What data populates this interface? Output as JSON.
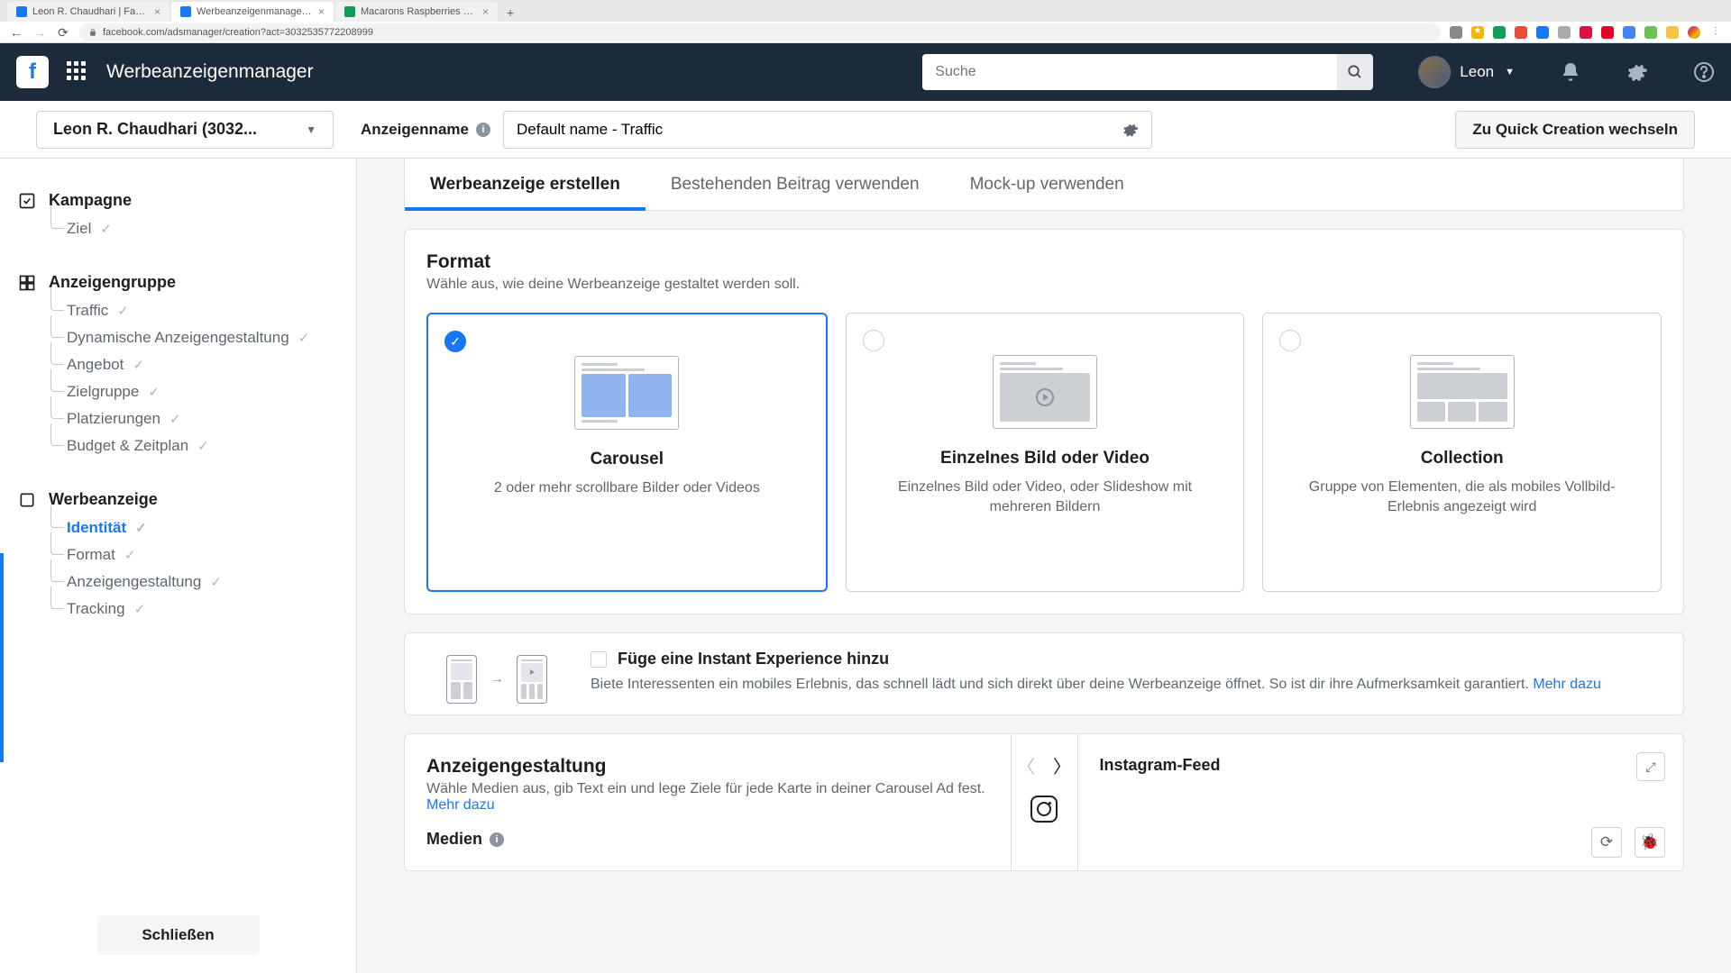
{
  "browser": {
    "tabs": [
      {
        "title": "Leon R. Chaudhari | Facebook",
        "favicon": "#1877f2"
      },
      {
        "title": "Werbeanzeigenmanager - Cre…",
        "favicon": "#1877f2",
        "active": true
      },
      {
        "title": "Macarons Raspberries Pastrie…",
        "favicon": "#0f9d58"
      }
    ],
    "url": "facebook.com/adsmanager/creation?act=3032535772208999"
  },
  "header": {
    "app_title": "Werbeanzeigenmanager",
    "search_placeholder": "Suche",
    "user_name": "Leon"
  },
  "subheader": {
    "account_label": "Leon R. Chaudhari (3032...",
    "ad_name_label": "Anzeigenname",
    "ad_name_value": "Default name - Traffic",
    "quick_btn": "Zu Quick Creation wechseln"
  },
  "sidebar": {
    "sections": [
      {
        "title": "Kampagne",
        "items": [
          {
            "label": "Ziel"
          }
        ]
      },
      {
        "title": "Anzeigengruppe",
        "items": [
          {
            "label": "Traffic"
          },
          {
            "label": "Dynamische Anzeigengestaltung"
          },
          {
            "label": "Angebot"
          },
          {
            "label": "Zielgruppe"
          },
          {
            "label": "Platzierungen"
          },
          {
            "label": "Budget & Zeitplan"
          }
        ]
      },
      {
        "title": "Werbeanzeige",
        "items": [
          {
            "label": "Identität",
            "active": true
          },
          {
            "label": "Format"
          },
          {
            "label": "Anzeigengestaltung"
          },
          {
            "label": "Tracking"
          }
        ]
      }
    ],
    "close": "Schließen"
  },
  "tabs": {
    "items": [
      {
        "label": "Werbeanzeige erstellen",
        "active": true
      },
      {
        "label": "Bestehenden Beitrag verwenden"
      },
      {
        "label": "Mock-up verwenden"
      }
    ]
  },
  "format": {
    "title": "Format",
    "subtitle": "Wähle aus, wie deine Werbeanzeige gestaltet werden soll.",
    "options": [
      {
        "title": "Carousel",
        "desc": "2 oder mehr scrollbare Bilder oder Videos",
        "selected": true
      },
      {
        "title": "Einzelnes Bild oder Video",
        "desc": "Einzelnes Bild oder Video, oder Slideshow mit mehreren Bildern"
      },
      {
        "title": "Collection",
        "desc": "Gruppe von Elementen, die als mobiles Vollbild-Erlebnis angezeigt wird"
      }
    ]
  },
  "instant": {
    "title": "Füge eine Instant Experience hinzu",
    "desc": "Biete Interessenten ein mobiles Erlebnis, das schnell lädt und sich direkt über deine Werbeanzeige öffnet. So ist dir ihre Aufmerksamkeit garantiert. ",
    "link": "Mehr dazu"
  },
  "design": {
    "title": "Anzeigengestaltung",
    "desc": "Wähle Medien aus, gib Text ein und lege Ziele für jede Karte in deiner Carousel Ad fest. ",
    "link": "Mehr dazu",
    "media_label": "Medien",
    "preview_title": "Instagram-Feed"
  }
}
